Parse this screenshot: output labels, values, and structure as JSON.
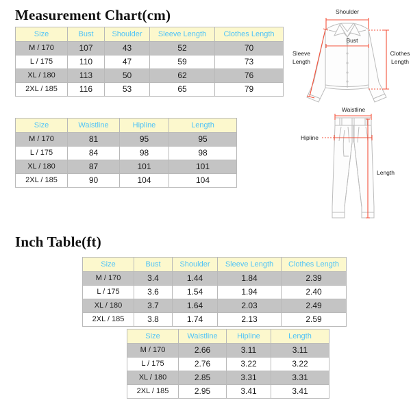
{
  "titles": {
    "cm": "Measurement Chart(cm)",
    "ft": "Inch Table(ft)"
  },
  "colors": {
    "header_bg": "#FCF8CD",
    "header_text": "#4FC3F7",
    "row_shade": "#C4C4C4",
    "row_plain": "#FFFFFF",
    "measure_line": "#F4523B",
    "garment_outline": "#BCBCBC",
    "border": "#B9B9B9"
  },
  "tables": {
    "cm_top": {
      "headers": [
        "Size",
        "Bust",
        "Shoulder",
        "Sleeve Length",
        "Clothes Length"
      ],
      "rows": [
        [
          "M / 170",
          "107",
          "43",
          "52",
          "70"
        ],
        [
          "L / 175",
          "110",
          "47",
          "59",
          "73"
        ],
        [
          "XL / 180",
          "113",
          "50",
          "62",
          "76"
        ],
        [
          "2XL / 185",
          "116",
          "53",
          "65",
          "79"
        ]
      ]
    },
    "cm_bottom": {
      "headers": [
        "Size",
        "Waistline",
        "Hipline",
        "Length"
      ],
      "rows": [
        [
          "M / 170",
          "81",
          "95",
          "95"
        ],
        [
          "L / 175",
          "84",
          "98",
          "98"
        ],
        [
          "XL / 180",
          "87",
          "101",
          "101"
        ],
        [
          "2XL / 185",
          "90",
          "104",
          "104"
        ]
      ]
    },
    "ft_top": {
      "headers": [
        "Size",
        "Bust",
        "Shoulder",
        "Sleeve Length",
        "Clothes Length"
      ],
      "rows": [
        [
          "M / 170",
          "3.4",
          "1.44",
          "1.84",
          "2.39"
        ],
        [
          "L / 175",
          "3.6",
          "1.54",
          "1.94",
          "2.40"
        ],
        [
          "XL / 180",
          "3.7",
          "1.64",
          "2.03",
          "2.49"
        ],
        [
          "2XL / 185",
          "3.8",
          "1.74",
          "2.13",
          "2.59"
        ]
      ]
    },
    "ft_bottom": {
      "headers": [
        "Size",
        "Waistline",
        "Hipline",
        "Length"
      ],
      "rows": [
        [
          "M / 170",
          "2.66",
          "3.11",
          "3.11"
        ],
        [
          "L / 175",
          "2.76",
          "3.22",
          "3.22"
        ],
        [
          "XL / 180",
          "2.85",
          "3.31",
          "3.31"
        ],
        [
          "2XL / 185",
          "2.95",
          "3.41",
          "3.41"
        ]
      ]
    }
  },
  "diagrams": {
    "shirt": {
      "name": "long-sleeve-shirt",
      "labels": {
        "shoulder": "Shoulder",
        "bust": "Bust",
        "sleeve_line1": "Sleeve",
        "sleeve_line2": "Length",
        "clothes_line1": "Clothes",
        "clothes_line2": "Length"
      }
    },
    "pants": {
      "name": "trousers",
      "labels": {
        "waistline": "Waistline",
        "hipline": "Hipline",
        "length": "Length"
      }
    }
  }
}
